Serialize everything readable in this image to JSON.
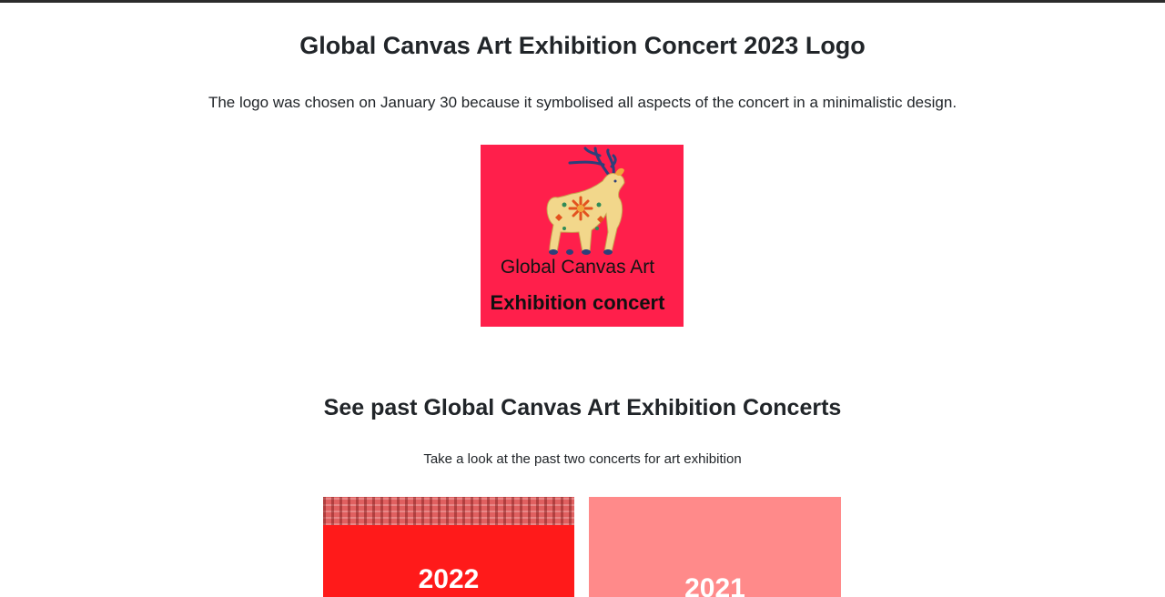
{
  "logo_section": {
    "title": "Global Canvas Art Exhibition Concert 2023 Logo",
    "description": "The logo was chosen on January 30 because it symbolised all aspects of the concert in a minimalistic design.",
    "logo": {
      "line1": "Global Canvas Art",
      "line2": "Exhibition concert",
      "background_color": "#ff1f4b",
      "icon": "reindeer-illustration"
    }
  },
  "past_section": {
    "title": "See past Global Canvas Art Exhibition Concerts",
    "description": "Take a look at the past two concerts for art exhibition",
    "cards": [
      {
        "year": "2022",
        "color": "#ff1a1a"
      },
      {
        "year": "2021",
        "color": "#ff8a8a"
      }
    ]
  }
}
